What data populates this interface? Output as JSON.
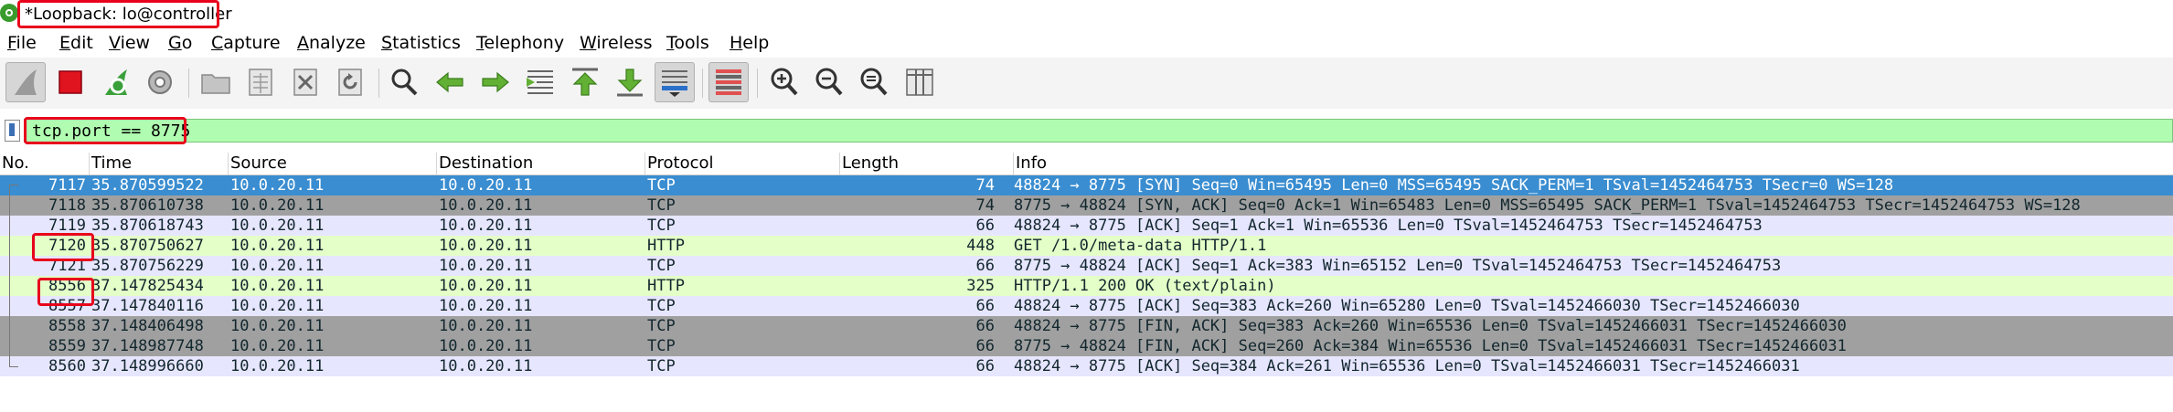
{
  "window": {
    "title": "*Loopback: lo@controller"
  },
  "menu": [
    "File",
    "Edit",
    "View",
    "Go",
    "Capture",
    "Analyze",
    "Statistics",
    "Telephony",
    "Wireless",
    "Tools",
    "Help"
  ],
  "filter": {
    "value": "tcp.port == 8775"
  },
  "columns": [
    "No.",
    "Time",
    "Source",
    "Destination",
    "Protocol",
    "Length",
    "Info"
  ],
  "colors": {
    "selected_row": "#3a8dd0",
    "tcp_flag_row": "#a0a0a0",
    "tcp_row": "#e7e6ff",
    "http_row": "#e4ffc7",
    "filter_bg": "#b0fcb0",
    "highlight": "#e8001c"
  },
  "packets": [
    {
      "no": "7117",
      "time": "35.870599522",
      "source": "10.0.20.11",
      "destination": "10.0.20.11",
      "protocol": "TCP",
      "length": "74",
      "info": "48824 → 8775 [SYN] Seq=0 Win=65495 Len=0 MSS=65495 SACK_PERM=1 TSval=1452464753 TSecr=0 WS=128",
      "kind": "selected"
    },
    {
      "no": "7118",
      "time": "35.870610738",
      "source": "10.0.20.11",
      "destination": "10.0.20.11",
      "protocol": "TCP",
      "length": "74",
      "info": "8775 → 48824 [SYN, ACK] Seq=0 Ack=1 Win=65483 Len=0 MSS=65495 SACK_PERM=1 TSval=1452464753 TSecr=1452464753 WS=128",
      "kind": "flag"
    },
    {
      "no": "7119",
      "time": "35.870618743",
      "source": "10.0.20.11",
      "destination": "10.0.20.11",
      "protocol": "TCP",
      "length": "66",
      "info": "48824 → 8775 [ACK] Seq=1 Ack=1 Win=65536 Len=0 TSval=1452464753 TSecr=1452464753",
      "kind": "tcp"
    },
    {
      "no": "7120",
      "time": "35.870750627",
      "source": "10.0.20.11",
      "destination": "10.0.20.11",
      "protocol": "HTTP",
      "length": "448",
      "info": "GET /1.0/meta-data HTTP/1.1",
      "kind": "http"
    },
    {
      "no": "7121",
      "time": "35.870756229",
      "source": "10.0.20.11",
      "destination": "10.0.20.11",
      "protocol": "TCP",
      "length": "66",
      "info": "8775 → 48824 [ACK] Seq=1 Ack=383 Win=65152 Len=0 TSval=1452464753 TSecr=1452464753",
      "kind": "tcp"
    },
    {
      "no": "8556",
      "time": "37.147825434",
      "source": "10.0.20.11",
      "destination": "10.0.20.11",
      "protocol": "HTTP",
      "length": "325",
      "info": "HTTP/1.1 200 OK  (text/plain)",
      "kind": "http"
    },
    {
      "no": "8557",
      "time": "37.147840116",
      "source": "10.0.20.11",
      "destination": "10.0.20.11",
      "protocol": "TCP",
      "length": "66",
      "info": "48824 → 8775 [ACK] Seq=383 Ack=260 Win=65280 Len=0 TSval=1452466030 TSecr=1452466030",
      "kind": "tcp"
    },
    {
      "no": "8558",
      "time": "37.148406498",
      "source": "10.0.20.11",
      "destination": "10.0.20.11",
      "protocol": "TCP",
      "length": "66",
      "info": "48824 → 8775 [FIN, ACK] Seq=383 Ack=260 Win=65536 Len=0 TSval=1452466031 TSecr=1452466030",
      "kind": "flag"
    },
    {
      "no": "8559",
      "time": "37.148987748",
      "source": "10.0.20.11",
      "destination": "10.0.20.11",
      "protocol": "TCP",
      "length": "66",
      "info": "8775 → 48824 [FIN, ACK] Seq=260 Ack=384 Win=65536 Len=0 TSval=1452466031 TSecr=1452466031",
      "kind": "flag"
    },
    {
      "no": "8560",
      "time": "37.148996660",
      "source": "10.0.20.11",
      "destination": "10.0.20.11",
      "protocol": "TCP",
      "length": "66",
      "info": "48824 → 8775 [ACK] Seq=384 Ack=261 Win=65536 Len=0 TSval=1452466031 TSecr=1452466031",
      "kind": "tcp"
    }
  ]
}
